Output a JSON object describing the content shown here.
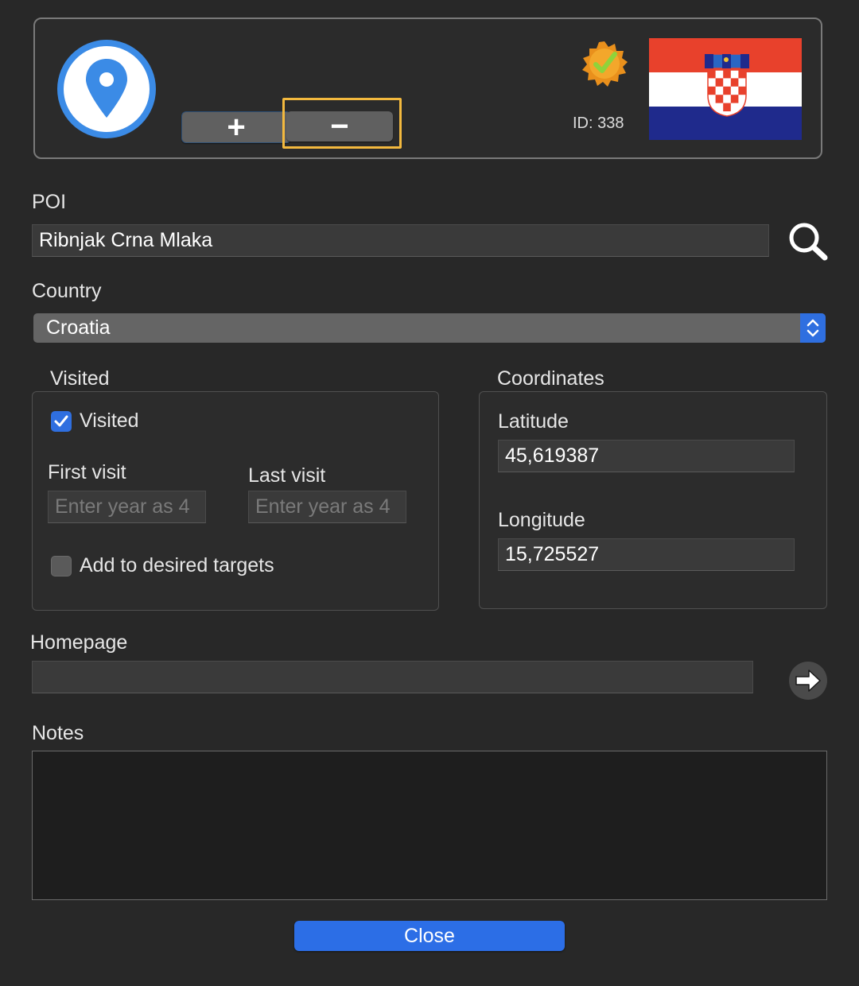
{
  "header": {
    "stepper": {
      "plus_label": "+",
      "minus_label": "−"
    },
    "id_label": "ID: 338"
  },
  "poi": {
    "label": "POI",
    "value": "Ribnjak Crna Mlaka"
  },
  "country": {
    "label": "Country",
    "value": "Croatia"
  },
  "visited": {
    "group_label": "Visited",
    "checkbox_label": "Visited",
    "checked": true,
    "first_visit_label": "First visit",
    "first_visit_placeholder": "Enter year as 4",
    "last_visit_label": "Last visit",
    "last_visit_placeholder": "Enter year as 4",
    "desired_label": "Add to desired targets",
    "desired_checked": false
  },
  "coordinates": {
    "group_label": "Coordinates",
    "latitude_label": "Latitude",
    "latitude_value": "45,619387",
    "longitude_label": "Longitude",
    "longitude_value": "15,725527"
  },
  "homepage": {
    "label": "Homepage",
    "value": ""
  },
  "notes": {
    "label": "Notes",
    "value": ""
  },
  "close_label": "Close",
  "colors": {
    "accent": "#2c6ee6",
    "focus": "#f3b93e",
    "pin": "#3b8be6"
  }
}
